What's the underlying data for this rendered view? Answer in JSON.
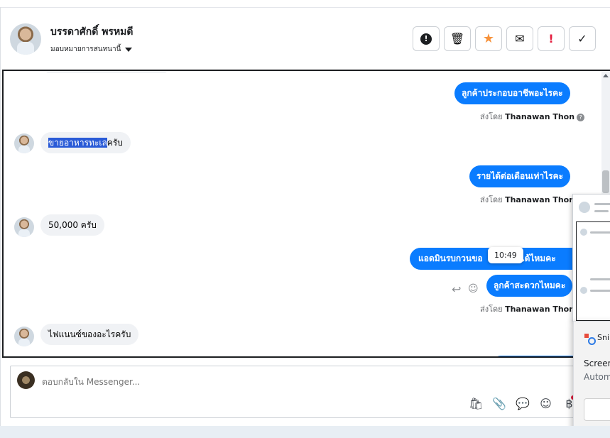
{
  "header": {
    "contact_name": "บรรดาศักดิ์ พรหมดี",
    "assign_label": "มอบหมายการสนทนานี้"
  },
  "toolbar": [
    {
      "name": "spam-button",
      "icon": "alert-circle-icon",
      "glyph": "!"
    },
    {
      "name": "delete-button",
      "icon": "trash-icon",
      "glyph": "🗑"
    },
    {
      "name": "star-button",
      "icon": "star-icon",
      "glyph": "★"
    },
    {
      "name": "mark-unread-button",
      "icon": "envelope-icon",
      "glyph": "✉"
    },
    {
      "name": "follow-up-button",
      "icon": "exclamation-icon",
      "glyph": "!"
    },
    {
      "name": "done-button",
      "icon": "check-icon",
      "glyph": "✓"
    }
  ],
  "messages": {
    "m1": "ลูกค้าประกอบอาชีพอะไรคะ",
    "sent_by_1": "ส่งโดย",
    "agent_1": "Thanawan Thon",
    "help_glyph": "?",
    "m2_highlight": "ขายอาหารทะเล",
    "m2_rest": "ครับ",
    "m3": "รายได้ต่อเดือนเท่าไรคะ",
    "sent_by_2": "ส่งโดย",
    "agent_2": "Thanawan Thon",
    "m4": "50,000 ครับ",
    "m5": "แอดมินรบกวนขอ",
    "m5_tail": "ต่อได้ไหมคะ",
    "tooltip": "10:49",
    "m6": "ลูกค้าสะดวกไหมคะ",
    "sent_by_3": "ส่งโดย",
    "agent_3": "Thanawan Thon",
    "m7": "ไฟแนนซ์ของอะไรครับ"
  },
  "compose": {
    "placeholder": "ตอบกลับใน Messenger..."
  },
  "compose_icons": [
    {
      "name": "shop-icon",
      "glyph": "🛍"
    },
    {
      "name": "attach-icon",
      "glyph": "📎"
    },
    {
      "name": "saved-reply-icon",
      "glyph": "💬"
    },
    {
      "name": "emoji-icon",
      "glyph": "☺"
    },
    {
      "name": "payment-icon",
      "glyph": "฿"
    }
  ],
  "snip": {
    "title": "Sni",
    "line1": "Screen",
    "line2": "Autom"
  },
  "colors": {
    "outgoing_bubble": "#0a7cff",
    "incoming_bubble": "#f0f2f5",
    "star": "#f7923b",
    "flag": "#e41e3f"
  }
}
